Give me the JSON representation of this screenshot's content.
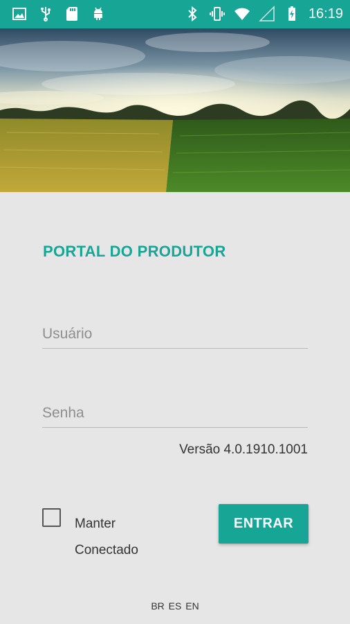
{
  "status_bar": {
    "time": "16:19",
    "left_icons": [
      "image-icon",
      "usb-icon",
      "sd-card-icon",
      "android-icon"
    ],
    "right_icons": [
      "bluetooth-icon",
      "vibrate-icon",
      "wifi-icon",
      "signal-icon",
      "battery-charging-icon"
    ]
  },
  "login": {
    "title": "PORTAL DO PRODUTOR",
    "username_placeholder": "Usuário",
    "password_placeholder": "Senha",
    "version": "Versão 4.0.1910.1001",
    "keep_connected": "Manter Conectado",
    "submit_label": "ENTRAR"
  },
  "languages": {
    "br": "BR",
    "es": "ES",
    "en": "EN"
  },
  "colors": {
    "accent": "#17a596",
    "background": "#e6e6e6"
  }
}
